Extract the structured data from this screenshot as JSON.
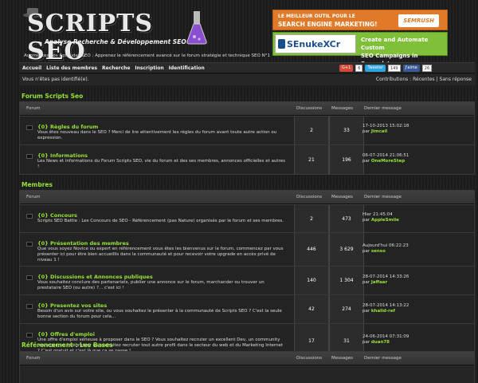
{
  "header": {
    "logo_title": "SCRIPTS SEO",
    "logo_subtitle": "Analyse Recherche & Développement SEO",
    "tagline": "Augmentez vos Aptitudes SEO : Apprenez le référencement avancé sur le forum stratégie et technique SEO N°1",
    "ad1": {
      "line1": "LE MEILLEUR OUTIL POUR LE",
      "line2": "SEARCH ENGINE MARKETING!",
      "brand": "SEMRUSH"
    },
    "ad2": {
      "brand": "SEnukeXCr",
      "line1": "Create and Automate Custom",
      "line2": "SEO Campaigns in Seconds!"
    }
  },
  "nav": {
    "items": [
      "Accueil",
      "Liste des membres",
      "Recherche",
      "Inscription",
      "Identification"
    ],
    "social": {
      "gplus_label": "G+1",
      "gplus_count": "6",
      "tweet_label": "Tweeter",
      "tweet_count": "149",
      "fb_label": "J'aime",
      "fb_count": "26"
    }
  },
  "subbar": {
    "status": "Vous n'êtes pas identifié(e).",
    "contrib_label": "Contributions :",
    "recent": "Récentes",
    "sep": "|",
    "unanswered": "Sans réponse"
  },
  "columns": {
    "forum": "Forum",
    "discussions": "Discussions",
    "messages": "Messages",
    "last": "Dernier message"
  },
  "sections": [
    {
      "title": "Forum Scripts Seo",
      "rows": [
        {
          "title": "{0} Règles du forum",
          "desc": "Vous êtes nouveau dans le SEO ? Merci de lire attentivement les règles du forum avant toute autre action ou expression.",
          "discussions": "2",
          "messages": "33",
          "last_date": "17-10-2013 15:02:18",
          "last_by": "par",
          "last_user": "Jimcail"
        },
        {
          "title": "{0} Informations",
          "desc": "Les News et informations du Forum Scripts SEO, vie du forum et des ses membres, annonces officielles et autres !",
          "discussions": "21",
          "messages": "196",
          "last_date": "06-07-2014 21:06:51",
          "last_by": "par",
          "last_user": "OneMoreStep"
        }
      ]
    },
    {
      "title": "Membres",
      "rows": [
        {
          "title": "{0} Concours",
          "desc": "Scripts SEO Battle : Les Concours de SEO - Référencement (pas Nature) organisés par le forum et ses membres.",
          "discussions": "2",
          "messages": "473",
          "last_date": "Hier 21:45:04",
          "last_by": "par",
          "last_user": "AppleSmile"
        },
        {
          "title": "{0} Présentation des membres",
          "desc": "Que vous soyez Novice ou expert en référencement vous êtes les bienvenus sur le forum, commencez par vous présenter ici pour être bien accueillis dans la communauté et pour recevoir votre upgrade en accès privé de niveau 1 !",
          "discussions": "446",
          "messages": "3 629",
          "last_date": "Aujourd'hui 06:22:23",
          "last_by": "par",
          "last_user": "senso"
        },
        {
          "title": "{0} Discussions et Annonces publiques",
          "desc": "Vous souhaitez conclure des partenariats, publier une annonce sur le forum, marchander ou trouver un prestataire SEO (ou autre) ?... c'est ici !",
          "discussions": "140",
          "messages": "1 304",
          "last_date": "28-07-2014 14:33:26",
          "last_by": "par",
          "last_user": "Jaffaar"
        },
        {
          "title": "{0} Presentez vos sites",
          "desc": "Besoin d'un avis sur votre site, ou vous souhaitez le présenter à la communauté de Scripts SEO ? C'est la seule bonne section du forum pour cela...",
          "discussions": "42",
          "messages": "274",
          "last_date": "28-07-2014 14:13:22",
          "last_by": "par",
          "last_user": "khalid-ref"
        },
        {
          "title": "{0} Offres d'emploi",
          "desc": "Une offre d'emploi sérieuse à proposer dans le SEO ? Vous souhaitez recruter un excellent Dev, un community manager, un intégrateur ou souhaitez recruter tout autre profil dans le secteur du web et du Marketing Internet ? C'est gratuit et c'est là que ça se passe !",
          "discussions": "17",
          "messages": "31",
          "last_date": "24-06-2014 07:31:09",
          "last_by": "par",
          "last_user": "duan78"
        }
      ]
    },
    {
      "title": "Référencement : Les Bases",
      "rows": []
    }
  ]
}
